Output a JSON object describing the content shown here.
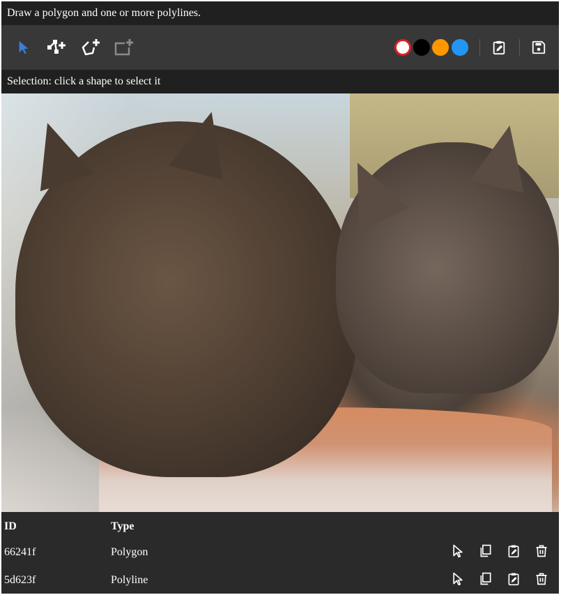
{
  "instruction": "Draw a polygon and one or more polylines.",
  "toolbar": {
    "tools": [
      {
        "name": "select-tool",
        "icon": "pointer-icon",
        "active": true
      },
      {
        "name": "polyline-tool",
        "icon": "add-polyline-icon",
        "active": false
      },
      {
        "name": "polygon-tool",
        "icon": "add-polygon-icon",
        "active": false
      },
      {
        "name": "rectangle-tool",
        "icon": "add-rectangle-icon",
        "active": false,
        "disabled": true
      }
    ],
    "colors": [
      "#ffffff",
      "#000000",
      "#ff9800",
      "#2196f3"
    ],
    "selected_color": "#ffffff",
    "selected_ring": "#e02020",
    "actions": [
      {
        "name": "edit-button",
        "icon": "clipboard-edit-icon"
      },
      {
        "name": "save-button",
        "icon": "save-icon"
      }
    ]
  },
  "selection": "Selection: click a shape to select it",
  "table": {
    "headers": {
      "id": "ID",
      "type": "Type"
    },
    "rows": [
      {
        "id": "66241f",
        "type": "Polygon"
      },
      {
        "id": "5d623f",
        "type": "Polyline"
      }
    ],
    "row_actions": [
      "select-icon",
      "copy-icon",
      "edit-icon",
      "delete-icon"
    ]
  },
  "accent": "#3b7fd9"
}
